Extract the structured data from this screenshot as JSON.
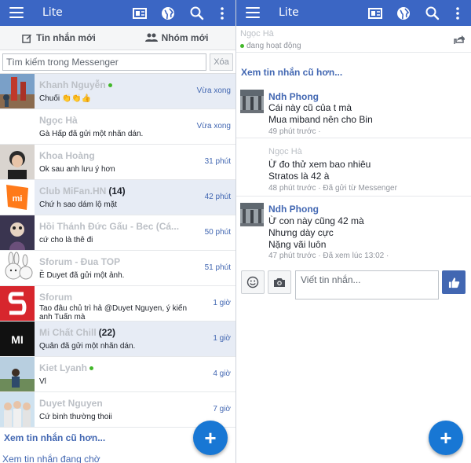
{
  "app": {
    "brand": "Lite"
  },
  "left": {
    "tabs": {
      "new_messages": "Tin nhắn mới",
      "new_groups": "Nhóm mới"
    },
    "search": {
      "placeholder": "Tìm kiếm trong Messenger",
      "clear_label": "Xóa"
    },
    "conversations": [
      {
        "name": "Khanh Nguyễn",
        "count": "",
        "online": true,
        "snippet": "Chuối 👏👏👍",
        "time": "Vừa xong",
        "highlight": true,
        "avatar": "photo-red-tower"
      },
      {
        "name": "Ngọc Hà",
        "count": "",
        "online": false,
        "snippet": "Gà Hấp đã gửi một nhãn dán.",
        "time": "Vừa xong",
        "highlight": false,
        "avatar": "blank"
      },
      {
        "name": "Khoa Hoàng",
        "count": "",
        "online": false,
        "snippet": "Ok sau anh lưu ý hơn",
        "time": "31 phút",
        "highlight": false,
        "avatar": "photo-person"
      },
      {
        "name": "Club MiFan.HN",
        "count": "(14)",
        "online": false,
        "snippet": "Chứ h sao dám lộ mặt",
        "time": "42 phút",
        "highlight": true,
        "avatar": "mi-logo-icon"
      },
      {
        "name": "Hồi Thánh Đức Gấu - Bec (Cá...",
        "count": "",
        "online": false,
        "snippet": "cứ cho là thê đi",
        "time": "50 phút",
        "highlight": false,
        "avatar": "photo-dark"
      },
      {
        "name": "Sforum - Đua TOP",
        "count": "",
        "online": false,
        "snippet": "Ȅ Duyet đã gửi một ảnh.",
        "time": "51 phút",
        "highlight": false,
        "avatar": "bunny-sticker"
      },
      {
        "name": "Sforum",
        "count": "",
        "online": false,
        "snippet": "Tao đâu chủ trì hả @Duyet Nguyen, ý kiến anh Tuấn mà",
        "time": "1 giờ",
        "highlight": false,
        "avatar": "sforum-logo-icon"
      },
      {
        "name": "Mi Chất Chill",
        "count": "(22)",
        "online": false,
        "snippet": "Quân đã gửi một nhãn dán.",
        "time": "1 giờ",
        "highlight": true,
        "avatar": "mi-black-logo-icon"
      },
      {
        "name": "Kiet Lyanh",
        "count": "",
        "online": true,
        "snippet": "Vl",
        "time": "4 giờ",
        "highlight": false,
        "avatar": "photo-outdoor"
      },
      {
        "name": "Duyet Nguyen",
        "count": "",
        "online": false,
        "snippet": "Cứ bình thường thoii",
        "time": "7 giờ",
        "highlight": false,
        "avatar": "photo-group"
      }
    ],
    "see_older": "Xem tin nhắn cũ hơn...",
    "waiting": "Xem tin nhắn đang chờ",
    "fab_label": "+"
  },
  "right": {
    "chat": {
      "name": "Ngọc Hà",
      "status": "đang hoạt động"
    },
    "see_older": "Xem tin nhắn cũ hơn...",
    "messages": [
      {
        "sender": "Ndh Phong",
        "lines": [
          "Cái này cũ của t mà",
          "Mua miband nên cho Bin"
        ],
        "meta": "49 phút trước ·"
      },
      {
        "sender": "Ngọc Hà",
        "lines": [
          "Ừ đo thử xem bao nhiêu",
          "Stratos là 42 à"
        ],
        "meta": "48 phút trước · Đã gửi từ Messenger"
      },
      {
        "sender": "Ndh Phong",
        "lines": [
          "Ừ con này cũng 42 mà",
          "Nhưng dày cực",
          "Nặng vãi luôn"
        ],
        "meta": "47 phút trước · Đã xem lúc 13:02 ·"
      }
    ],
    "composer": {
      "placeholder": "Viết tin nhắn..."
    },
    "fab_label": "+"
  },
  "colors": {
    "accent": "#3b66c4",
    "link": "#4267b2",
    "online": "#42b72a",
    "highlight": "#e7ecf5"
  }
}
